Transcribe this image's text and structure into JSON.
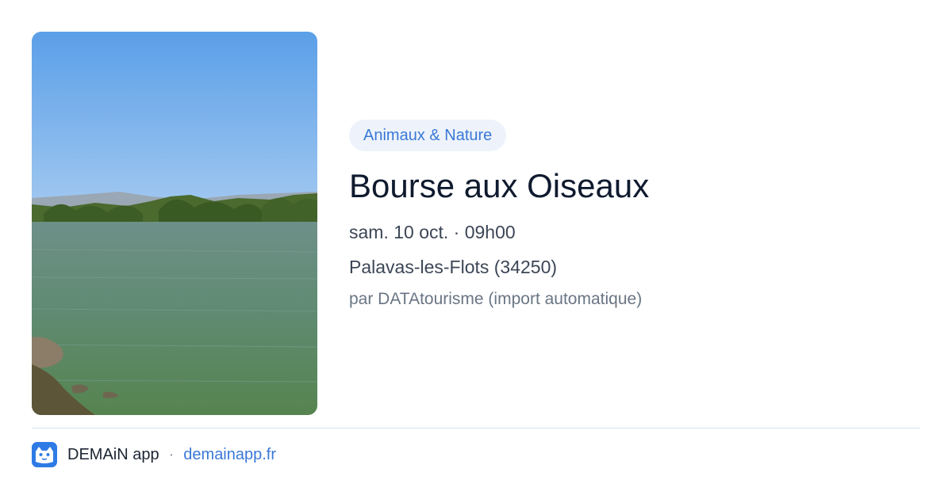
{
  "event": {
    "image_alt": "Étang avec végétation et ciel bleu",
    "category": "Animaux & Nature",
    "title": "Bourse aux Oiseaux",
    "datetime": "sam. 10 oct. · 09h00",
    "location": "Palavas-les-Flots (34250)",
    "author": "par DATAtourisme (import automatique)"
  },
  "footer": {
    "logo_icon": "demain-app-logo-icon",
    "brand": "DEMAiN app",
    "separator": "·",
    "site": "demainapp.fr"
  },
  "colors": {
    "accent": "#3a78d6",
    "tag_bg": "#eef3fb",
    "title": "#0f1a2e",
    "divider": "#d8e2ec"
  }
}
